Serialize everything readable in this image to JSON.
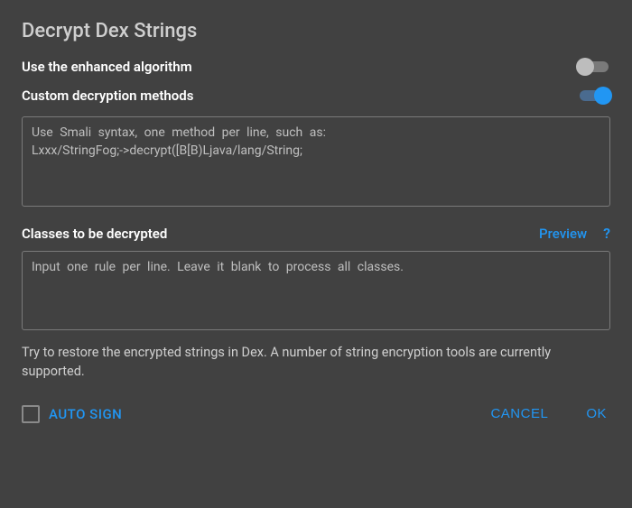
{
  "title": "Decrypt Dex Strings",
  "options": {
    "enhanced_algorithm": {
      "label": "Use the enhanced algorithm",
      "enabled": false
    },
    "custom_methods": {
      "label": "Custom decryption methods",
      "enabled": true
    }
  },
  "custom_methods_textarea": {
    "value": "",
    "placeholder": "Use Smali syntax, one method per line, such as:\nLxxx/StringFog;->decrypt([B[B)Ljava/lang/String;"
  },
  "classes_section": {
    "label": "Classes to be decrypted",
    "preview_label": "Preview",
    "help_label": "?"
  },
  "classes_textarea": {
    "value": "",
    "placeholder": "Input one rule per line. Leave it blank to process all classes."
  },
  "description": "Try to restore the encrypted strings in Dex. A number of string encryption tools are currently supported.",
  "footer": {
    "auto_sign_label": "AUTO SIGN",
    "auto_sign_checked": false,
    "cancel_label": "CANCEL",
    "ok_label": "OK"
  }
}
